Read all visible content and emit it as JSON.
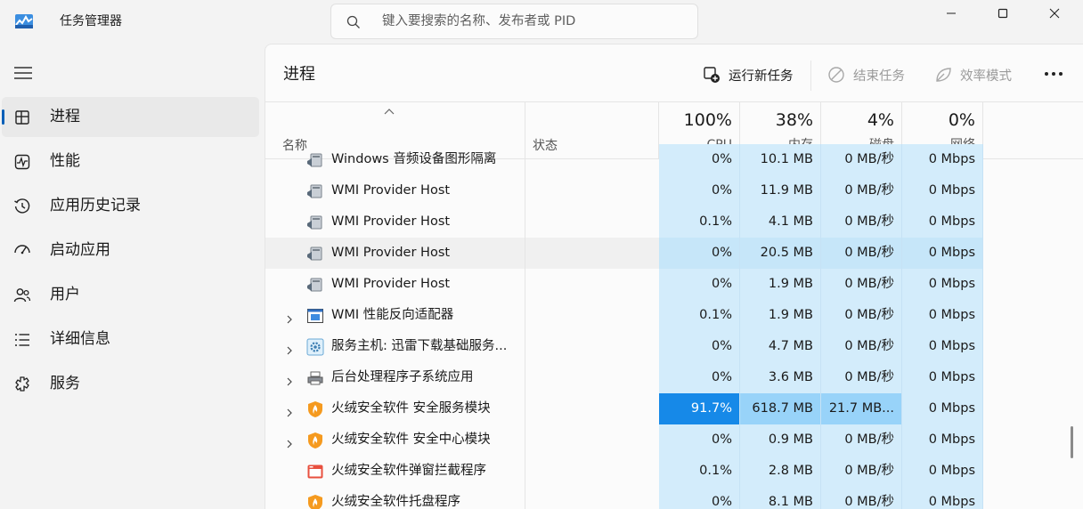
{
  "app": {
    "title": "任务管理器"
  },
  "search": {
    "placeholder": "键入要搜索的名称、发布者或 PID"
  },
  "sidebar": {
    "items": [
      {
        "label": "进程",
        "icon": "processes-icon",
        "active": true
      },
      {
        "label": "性能",
        "icon": "performance-icon"
      },
      {
        "label": "应用历史记录",
        "icon": "app-history-icon"
      },
      {
        "label": "启动应用",
        "icon": "startup-apps-icon"
      },
      {
        "label": "用户",
        "icon": "users-icon"
      },
      {
        "label": "详细信息",
        "icon": "details-icon"
      },
      {
        "label": "服务",
        "icon": "services-icon"
      }
    ]
  },
  "page": {
    "title": "进程"
  },
  "toolbar": {
    "run_task": "运行新任务",
    "end_task": "结束任务",
    "efficiency": "效率模式"
  },
  "columns": {
    "name": "名称",
    "status": "状态",
    "cpu": {
      "pct": "100%",
      "label": "CPU"
    },
    "memory": {
      "pct": "38%",
      "label": "内存"
    },
    "disk": {
      "pct": "4%",
      "label": "磁盘"
    },
    "network": {
      "pct": "0%",
      "label": "网络"
    }
  },
  "partial_row": {
    "name": "Windows 音频设备图形隔离",
    "cpu": "0%",
    "memory": "10.1 MB",
    "disk": "0 MB/秒",
    "network": "0 Mbps"
  },
  "rows": [
    {
      "name": "WMI Provider Host",
      "icon": "wmi-host-icon",
      "expandable": false,
      "cpu": "0%",
      "memory": "11.9 MB",
      "disk": "0 MB/秒",
      "network": "0 Mbps"
    },
    {
      "name": "WMI Provider Host",
      "icon": "wmi-host-icon",
      "expandable": false,
      "cpu": "0.1%",
      "memory": "4.1 MB",
      "disk": "0 MB/秒",
      "network": "0 Mbps"
    },
    {
      "name": "WMI Provider Host",
      "icon": "wmi-host-icon",
      "expandable": false,
      "cpu": "0%",
      "memory": "20.5 MB",
      "disk": "0 MB/秒",
      "network": "0 Mbps",
      "hover": true
    },
    {
      "name": "WMI Provider Host",
      "icon": "wmi-host-icon",
      "expandable": false,
      "cpu": "0%",
      "memory": "1.9 MB",
      "disk": "0 MB/秒",
      "network": "0 Mbps"
    },
    {
      "name": "WMI 性能反向适配器",
      "icon": "window-app-icon",
      "expandable": true,
      "cpu": "0.1%",
      "memory": "1.9 MB",
      "disk": "0 MB/秒",
      "network": "0 Mbps"
    },
    {
      "name": "服务主机: 迅雷下载基础服务...",
      "icon": "service-gear-icon",
      "expandable": true,
      "cpu": "0%",
      "memory": "4.7 MB",
      "disk": "0 MB/秒",
      "network": "0 Mbps"
    },
    {
      "name": "后台处理程序子系统应用",
      "icon": "printer-icon",
      "expandable": true,
      "cpu": "0%",
      "memory": "3.6 MB",
      "disk": "0 MB/秒",
      "network": "0 Mbps"
    },
    {
      "name": "火绒安全软件 安全服务模块",
      "icon": "huorong-shield-icon",
      "expandable": true,
      "cpu": "91.7%",
      "memory": "618.7 MB",
      "disk": "21.7 MB...",
      "network": "0 Mbps",
      "hot": true
    },
    {
      "name": "火绒安全软件 安全中心模块",
      "icon": "huorong-shield-icon",
      "expandable": true,
      "cpu": "0%",
      "memory": "0.9 MB",
      "disk": "0 MB/秒",
      "network": "0 Mbps"
    },
    {
      "name": "火绒安全软件弹窗拦截程序",
      "icon": "popup-block-icon",
      "expandable": false,
      "cpu": "0.1%",
      "memory": "2.8 MB",
      "disk": "0 MB/秒",
      "network": "0 Mbps"
    },
    {
      "name": "火绒安全软件托盘程序",
      "icon": "huorong-shield-icon",
      "expandable": false,
      "cpu": "0%",
      "memory": "8.1 MB",
      "disk": "0 MB/秒",
      "network": "0 Mbps"
    }
  ]
}
